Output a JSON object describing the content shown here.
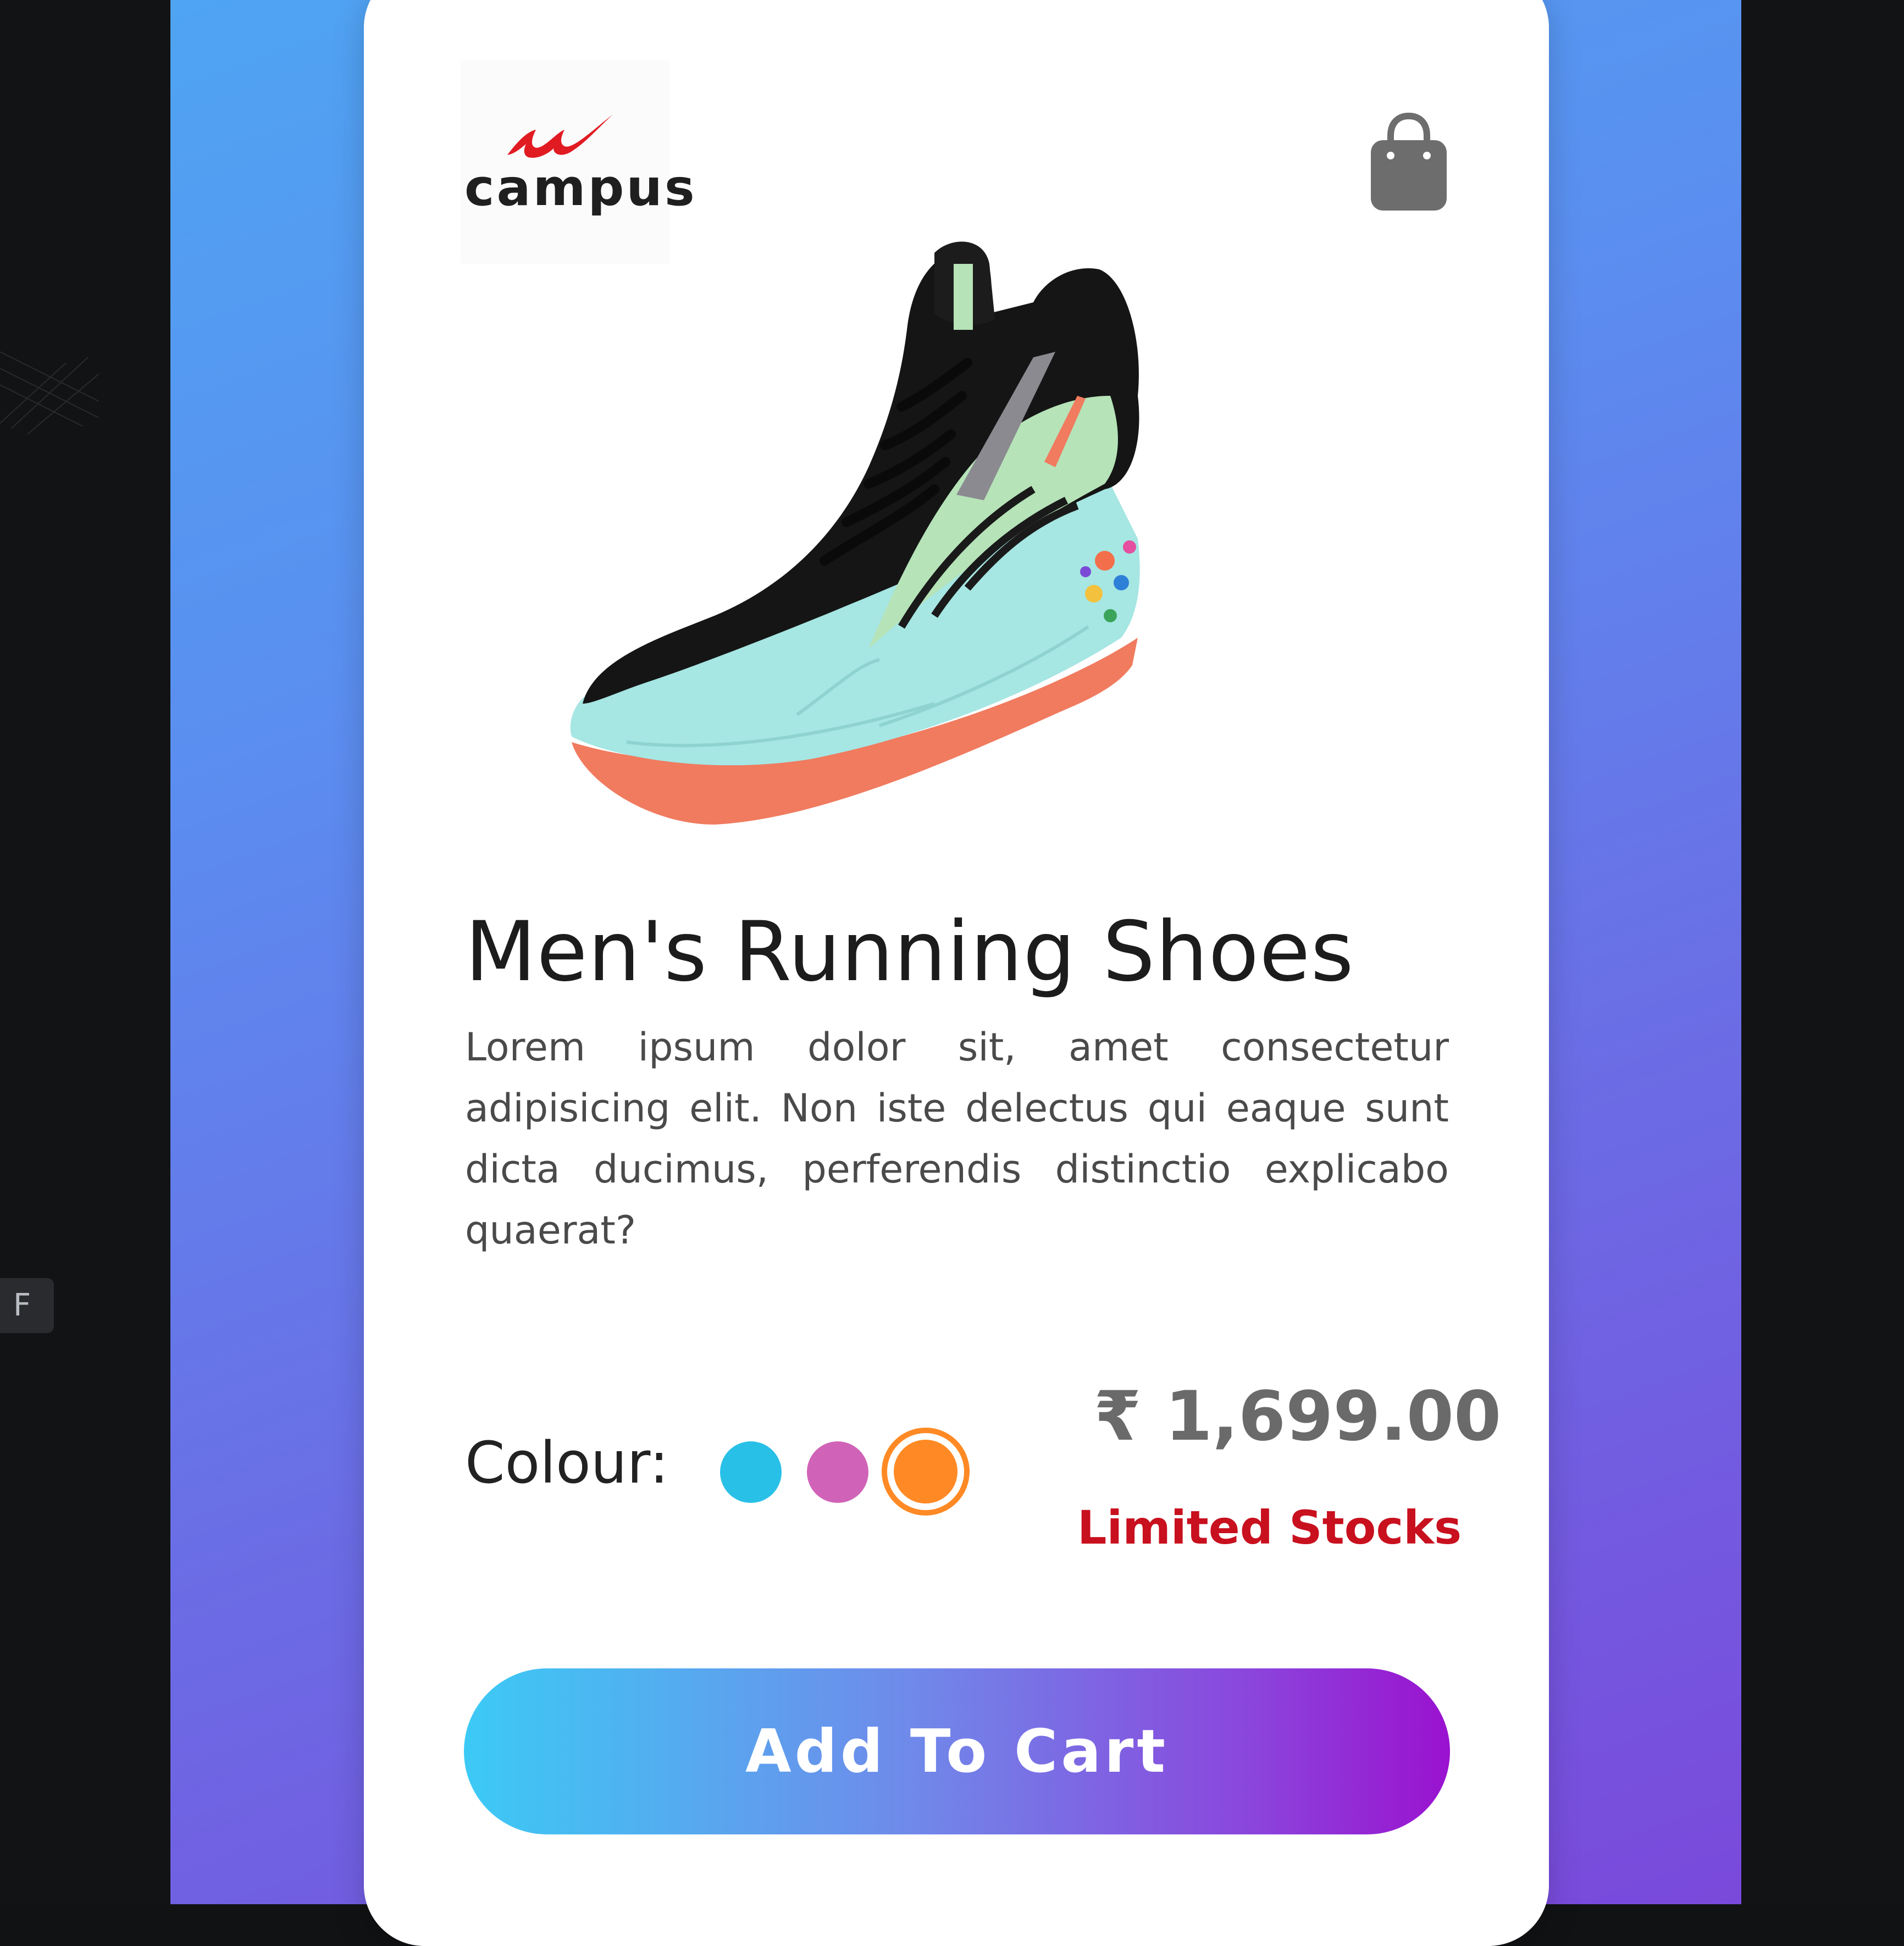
{
  "sidebar": {
    "key_label": "F"
  },
  "brand": {
    "name": "campus",
    "mark_color": "#e11b22"
  },
  "header": {
    "bag_icon": "shopping-bag-icon"
  },
  "product": {
    "title": "Men's Running Shoes",
    "description": "Lorem ipsum dolor sit, amet consectetur adipisicing elit. Non iste delectus qui eaque sunt dicta ducimus, perferendis distinctio explicabo quaerat?",
    "colour_label": "Colour:",
    "colours": [
      {
        "name": "blue",
        "hex": "#29c0e8",
        "selected": false
      },
      {
        "name": "pink",
        "hex": "#d063b7",
        "selected": false
      },
      {
        "name": "orange",
        "hex": "#ff8a25",
        "selected": true
      }
    ],
    "price": "₹ 1,699.00",
    "stock_status": "Limited Stocks",
    "stock_color": "#c8101e"
  },
  "actions": {
    "add_to_cart_label": "Add To Cart"
  },
  "theme": {
    "gradient_start": "#4fa4f3",
    "gradient_end": "#7a49db",
    "button_gradient_start": "#3ccaf5",
    "button_gradient_end": "#9a12cf"
  }
}
